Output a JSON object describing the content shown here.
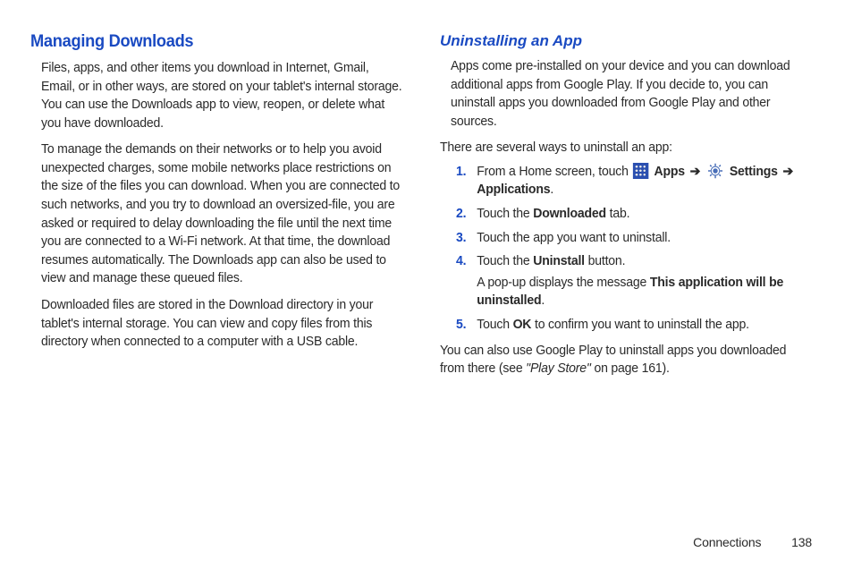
{
  "left": {
    "heading": "Managing Downloads",
    "p1": "Files, apps, and other items you download in Internet, Gmail, Email, or in other ways, are stored on your tablet's internal storage. You can use the Downloads app to view, reopen, or delete what you have downloaded.",
    "p2": "To manage the demands on their networks or to help you avoid unexpected charges, some mobile networks place restrictions on the size of the files you can download. When you are connected to such networks, and you try to download an oversized-file, you are asked or required to delay downloading the file until the next time you are connected to a Wi-Fi network. At that time, the download resumes automatically. The Downloads app can also be used to view and manage these queued files.",
    "p3": "Downloaded files are stored in the Download directory in your tablet's internal storage. You can view and copy files from this directory when connected to a computer with a USB cable."
  },
  "right": {
    "heading": "Uninstalling an App",
    "p1": "Apps come pre-installed on your device and you can download additional apps from Google Play. If you decide to, you can uninstall apps you downloaded from Google Play and other sources.",
    "p2": "There are several ways to uninstall an app:",
    "step1_a": "From a Home screen, touch ",
    "step1_apps": "Apps",
    "step1_settings": "Settings",
    "step1_applications": "Applications",
    "step2_a": "Touch the ",
    "step2_b": "Downloaded",
    "step2_c": " tab.",
    "step3": "Touch the app you want to uninstall.",
    "step4_a": "Touch the ",
    "step4_b": "Uninstall",
    "step4_c": " button.",
    "step4_d": "A pop-up displays the message ",
    "step4_e": "This application will be uninstalled",
    "step5_a": "Touch ",
    "step5_b": "OK",
    "step5_c": " to confirm you want to uninstall the app.",
    "p3_a": "You can also use Google Play to uninstall apps you downloaded from there (see ",
    "p3_b": "\"Play Store\"",
    "p3_c": " on page 161).",
    "num1": "1.",
    "num2": "2.",
    "num3": "3.",
    "num4": "4.",
    "num5": "5.",
    "arrow": "➔",
    "dot": "."
  },
  "footer": {
    "section": "Connections",
    "page": "138"
  }
}
